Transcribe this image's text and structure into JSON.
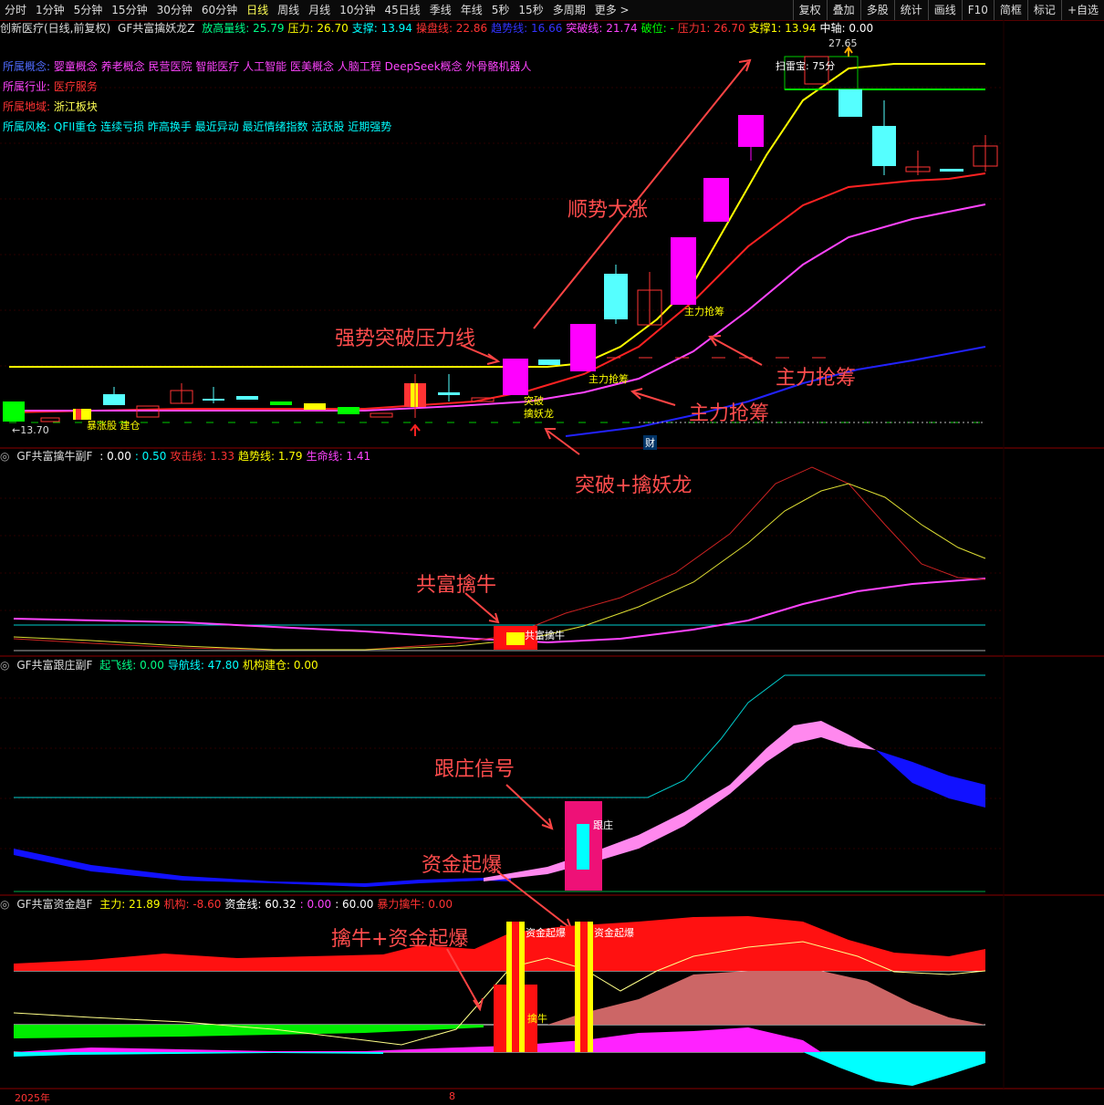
{
  "toolbar": {
    "periods": [
      "分时",
      "1分钟",
      "5分钟",
      "15分钟",
      "30分钟",
      "60分钟",
      "日线",
      "周线",
      "月线",
      "10分钟",
      "45日线",
      "季线",
      "年线",
      "5秒",
      "15秒",
      "多周期",
      "更多 >"
    ],
    "active": "日线",
    "right_tools": [
      "复权",
      "叠加",
      "多股",
      "统计",
      "画线",
      "F10",
      "简框",
      "标记",
      "+自选"
    ]
  },
  "main_header": {
    "stock": "创新医疗(日线,前复权)",
    "indicator": "GF共富擒妖龙Z",
    "items": [
      {
        "label": "放高量线: 25.79",
        "color": "#00ff88"
      },
      {
        "label": "压力: 26.70",
        "color": "#ffff00"
      },
      {
        "label": "支撑: 13.94",
        "color": "#00ffff"
      },
      {
        "label": "操盘线: 22.86",
        "color": "#ff3333"
      },
      {
        "label": "趋势线: 16.66",
        "color": "#3333ff"
      },
      {
        "label": "突破线: 21.74",
        "color": "#ff44ff"
      },
      {
        "label": "破位: -",
        "color": "#00ff00"
      },
      {
        "label": "压力1: 26.70",
        "color": "#ff3333"
      },
      {
        "label": "支撑1: 13.94",
        "color": "#ffff00"
      },
      {
        "label": "中轴: 0.00",
        "color": "#ffffff"
      }
    ]
  },
  "info": {
    "concept_label": "所属概念:",
    "concept_value": "婴童概念 养老概念 民营医院 智能医疗 人工智能 医美概念 人脑工程 DeepSeek概念 外骨骼机器人",
    "industry_label": "所属行业:",
    "industry_value": "医疗服务",
    "region_label": "所属地域:",
    "region_value": "浙江板块",
    "style_label": "所属风格:",
    "style_value": "QFII重仓 连续亏损 昨高换手 最近异动 最近情绪指数 活跃股 近期强势"
  },
  "price_labels": {
    "high": "27.65",
    "low": "←13.70",
    "scan": "扫雷宝: 75分",
    "fin": "财"
  },
  "signals": {
    "zhuli1": "主力抢筹",
    "zhuli2": "主力抢筹",
    "tupo": "突破",
    "qinyao": "擒妖龙",
    "jianyi": "暴涨股 建仓"
  },
  "annotations": {
    "shunshi": "顺势大涨",
    "qiangshi": "强势突破压力线",
    "zhuli_a": "主力抢筹",
    "zhuli_b": "主力抢筹",
    "tupo_qin": "突破+擒妖龙",
    "gongfu": "共富擒牛",
    "genzhuang": "跟庄信号",
    "zijin": "资金起爆",
    "qinniu_zijin": "擒牛+资金起爆"
  },
  "panel2": {
    "title": "GF共富擒牛副F",
    "items": [
      {
        "label": ": 0.00",
        "color": "#ffffff"
      },
      {
        "label": ": 0.50",
        "color": "#00ffff"
      },
      {
        "label": "攻击线: 1.33",
        "color": "#ff3333"
      },
      {
        "label": "趋势线: 1.79",
        "color": "#ffff00"
      },
      {
        "label": "生命线: 1.41",
        "color": "#ff44ff"
      }
    ],
    "signal": "共富擒牛"
  },
  "panel3": {
    "title": "GF共富跟庄副F",
    "items": [
      {
        "label": "起飞线: 0.00",
        "color": "#00ff88"
      },
      {
        "label": "导航线: 47.80",
        "color": "#00ffff"
      },
      {
        "label": "机构建仓: 0.00",
        "color": "#ffff00"
      }
    ],
    "signal": "跟庄"
  },
  "panel4": {
    "title": "GF共富资金趋F",
    "items": [
      {
        "label": "主力: 21.89",
        "color": "#ffff00"
      },
      {
        "label": "机构: -8.60",
        "color": "#ff3333"
      },
      {
        "label": "资金线: 60.32",
        "color": "#ffffff"
      },
      {
        "label": ": 0.00",
        "color": "#ff44ff"
      },
      {
        "label": ": 60.00",
        "color": "#ffffff"
      },
      {
        "label": "暴力擒牛: 0.00",
        "color": "#ff3333"
      }
    ],
    "signal1": "资金起爆",
    "signal2": "资金起爆",
    "signal3": "擒牛"
  },
  "bottom_axis": {
    "year": "2025年",
    "month": "8"
  },
  "colors": {
    "up": "#ff3333",
    "down": "#55ffff",
    "accent": "#ffff00",
    "divider": "#8b0000"
  }
}
